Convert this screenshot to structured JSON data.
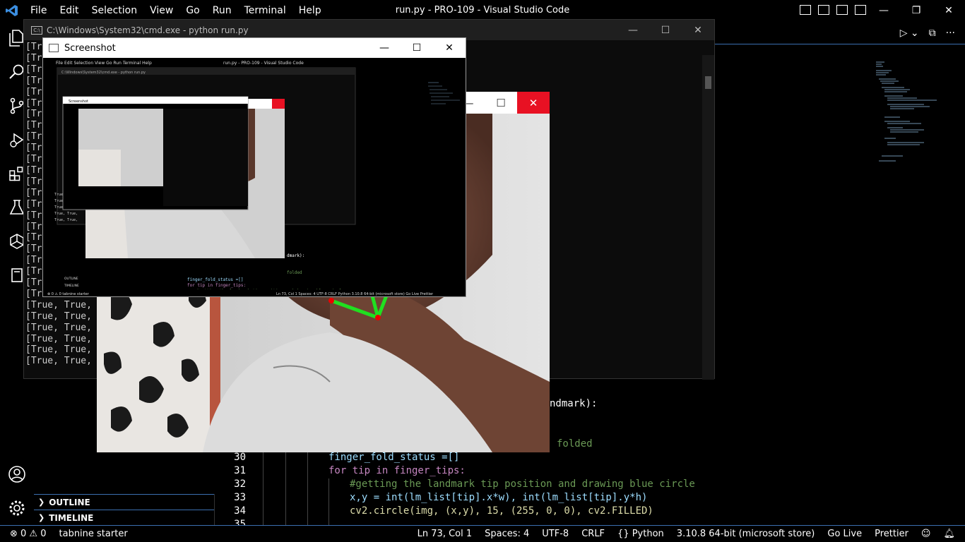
{
  "vscode": {
    "menu": [
      "File",
      "Edit",
      "Selection",
      "View",
      "Go",
      "Run",
      "Terminal",
      "Help"
    ],
    "window_title": "run.py - PRO-109 - Visual Studio Code",
    "sidebar_sections": [
      "OUTLINE",
      "TIMELINE"
    ],
    "code_lines": [
      {
        "num": "",
        "text": "ndmark):"
      },
      {
        "num": "",
        "text": "folded"
      },
      {
        "num": "30",
        "text": "finger_fold_status =[]"
      },
      {
        "num": "31",
        "text": "for tip in finger_tips:"
      },
      {
        "num": "32",
        "text": "#getting the landmark tip position and drawing blue circle"
      },
      {
        "num": "33",
        "text": "x,y = int(lm_list[tip].x*w), int(lm_list[tip].y*h)"
      },
      {
        "num": "34",
        "text": "cv2.circle(img, (x,y), 15, (255, 0, 0), cv2.FILLED)"
      },
      {
        "num": "35",
        "text": ""
      }
    ],
    "status_left": [
      "⊗ 0  ⚠ 0",
      "tabnine starter"
    ],
    "status_right": [
      "Ln 73, Col 1",
      "Spaces: 4",
      "UTF-8",
      "CRLF",
      "{} Python",
      "3.10.8 64-bit (microsoft store)",
      "Go Live",
      "Prettier"
    ]
  },
  "cmd": {
    "title": "C:\\Windows\\System32\\cmd.exe - python  run.py",
    "lines": [
      "[Tr",
      "[Tr",
      "[Tr",
      "[Tr",
      "[Tr",
      "[Tr",
      "[Tr",
      "[Tr",
      "[Tr",
      "[Tr",
      "[Tr",
      "[Tr",
      "[Tr",
      "[Tr",
      "[Tr",
      "[Tr",
      "[Tr",
      "[Tr",
      "[Tr",
      "[Tr",
      "[Tr",
      "[Tr",
      "[Tr",
      "[True, True,",
      "[True, True,",
      "[True, True,",
      "[True, True,",
      "[True, True,",
      "[True, True,"
    ]
  },
  "screenshot": {
    "title": "Screenshot"
  }
}
